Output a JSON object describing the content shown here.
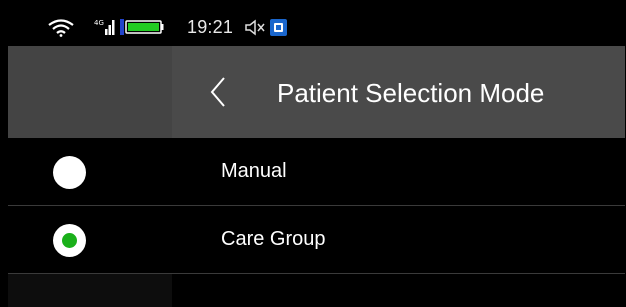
{
  "status_bar": {
    "time": "19:21",
    "icons": [
      "wifi-icon",
      "signal-icon",
      "battery-icon",
      "mute-icon",
      "app-icon"
    ],
    "battery_color": "#22cc22"
  },
  "header": {
    "back_icon": "chevron-left-icon",
    "title": "Patient Selection Mode"
  },
  "options": [
    {
      "label": "Manual",
      "selected": false
    },
    {
      "label": "Care Group",
      "selected": true
    }
  ],
  "colors": {
    "header_bg": "#4a4a4a",
    "background": "#000000",
    "selected_dot": "#1ab01a",
    "radio": "#ffffff",
    "text": "#ffffff"
  }
}
